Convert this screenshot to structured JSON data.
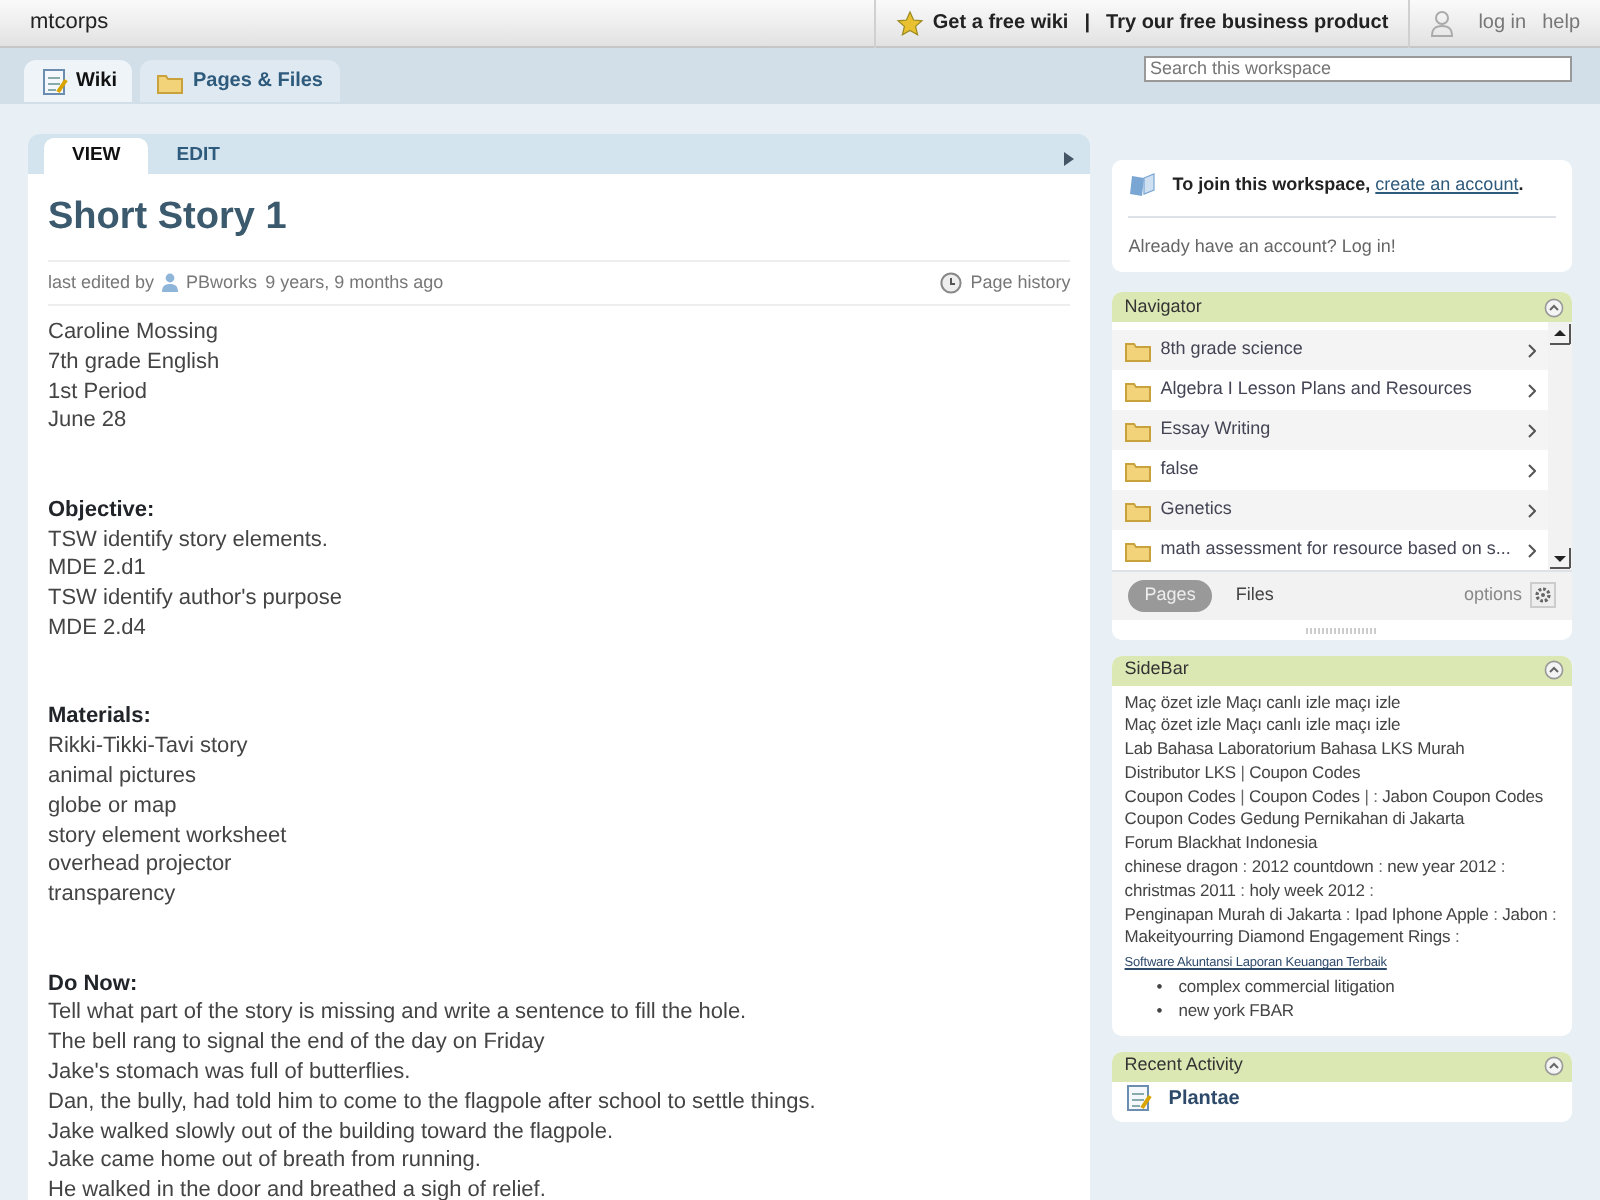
{
  "topbar": {
    "site": "mtcorps",
    "promo": "Get a free wiki",
    "separator": "|",
    "business": "Try our free business product",
    "login": "log in",
    "help": "help"
  },
  "tabs": [
    {
      "label": "Wiki",
      "selected": true
    },
    {
      "label": "Pages & Files",
      "selected": false
    }
  ],
  "search": {
    "placeholder": "Search this workspace"
  },
  "page": {
    "view_tabs": [
      {
        "label": "VIEW",
        "selected": true
      },
      {
        "label": "EDIT",
        "selected": false
      }
    ],
    "title": "Short Story 1",
    "meta": {
      "prefix": "last edited by",
      "user": "PBworks",
      "time": "9 years, 9 months ago"
    },
    "history": "Page history",
    "blocks": [
      {
        "lines": [
          "Caroline Mossing",
          "7th grade English",
          "1st Period",
          "June 28"
        ]
      },
      {
        "heading": "Objective:",
        "lines": [
          "TSW identify story elements.",
          "MDE 2.d1",
          "TSW identify author's purpose",
          "MDE 2.d4"
        ]
      },
      {
        "heading": "Materials:",
        "lines": [
          "Rikki-Tikki-Tavi story",
          "animal pictures",
          "globe or map",
          "story element worksheet",
          "overhead projector",
          "transparency"
        ]
      },
      {
        "heading": "Do Now:",
        "lines": [
          "Tell what part of the story is missing and write a sentence to fill the hole.",
          "The bell rang to signal the end of the day on Friday",
          "Jake's stomach was full of butterflies.",
          "Dan, the bully, had told him to come to the flagpole after school to settle things.",
          "Jake walked slowly out of the building toward the flagpole.",
          "Jake came home out of breath from running.",
          "He walked in the door and breathed a sigh of relief."
        ]
      }
    ]
  },
  "join": {
    "text": "To join this workspace,",
    "link": "create an account",
    "end": ".",
    "login_text": "Already have an account?",
    "login_link": "Log in",
    "login_end": "!"
  },
  "navigator": {
    "title": "Navigator",
    "items": [
      "8th grade science",
      "Algebra I Lesson Plans and Resources",
      "Essay Writing",
      "false",
      "Genetics",
      "math assessment for resource based on s..."
    ],
    "footer_tabs": [
      {
        "label": "Pages",
        "selected": true
      },
      {
        "label": "Files",
        "selected": false
      }
    ],
    "options": "options"
  },
  "sidebar": {
    "title": "SideBar",
    "paragraphs": [
      [
        {
          "kind": "link",
          "text": "Maç özet izle"
        },
        {
          "kind": "link",
          "text": "Maçı canlı izle"
        },
        {
          "kind": "link",
          "text": "maçı izle"
        }
      ],
      [
        {
          "kind": "link",
          "text": "Maç özet izle"
        },
        {
          "kind": "link",
          "text": "Maçı canlı izle"
        },
        {
          "kind": "link",
          "text": "maçı izle"
        }
      ],
      [
        {
          "kind": "link",
          "text": "Lab Bahasa"
        },
        {
          "kind": "link",
          "text": "Laboratorium Bahasa"
        },
        {
          "kind": "link",
          "text": "LKS Murah"
        },
        {
          "kind": "link",
          "text": "Distributor LKS"
        },
        {
          "kind": "text",
          "text": "|"
        },
        {
          "kind": "link",
          "text": "Coupon Codes"
        }
      ],
      [
        {
          "kind": "link",
          "text": "Coupon Codes"
        },
        {
          "kind": "text",
          "text": "|"
        },
        {
          "kind": "link",
          "text": "Coupon Codes"
        },
        {
          "kind": "text",
          "text": "| :"
        },
        {
          "kind": "link",
          "text": "Jabon"
        },
        {
          "kind": "link",
          "text": "Coupon Codes"
        },
        {
          "kind": "link",
          "text": "Coupon Codes"
        },
        {
          "kind": "link",
          "text": "Gedung Pernikahan di Jakarta"
        },
        {
          "kind": "link",
          "text": "Forum Blackhat Indonesia"
        }
      ],
      [
        {
          "kind": "link",
          "text": "chinese dragon"
        },
        {
          "kind": "text",
          "text": ":"
        },
        {
          "kind": "link",
          "text": "2012 countdown"
        },
        {
          "kind": "text",
          "text": ":"
        },
        {
          "kind": "link",
          "text": "new year 2012"
        },
        {
          "kind": "text",
          "text": ":"
        },
        {
          "kind": "link",
          "text": "christmas 2011"
        },
        {
          "kind": "text",
          "text": ":"
        },
        {
          "kind": "link",
          "text": "holy week 2012"
        },
        {
          "kind": "text",
          "text": ":"
        },
        {
          "kind": "link",
          "text": "Penginapan Murah di Jakarta"
        },
        {
          "kind": "text",
          "text": ":"
        },
        {
          "kind": "link",
          "text": "Ipad Iphone Apple"
        },
        {
          "kind": "text",
          "text": ":"
        },
        {
          "kind": "link",
          "text": "Jabon"
        },
        {
          "kind": "text",
          "text": ":"
        },
        {
          "kind": "link",
          "text": "Makeityourring Diamond Engagement Rings"
        },
        {
          "kind": "text",
          "text": ":"
        },
        {
          "kind": "small-link",
          "text": "Software Akuntansi Laporan Keuangan Terbaik"
        }
      ]
    ],
    "bullets": [
      {
        "marker": "•",
        "text": "complex commercial litigation"
      },
      {
        "marker": "•",
        "text": "new york FBAR"
      }
    ]
  },
  "recent": {
    "title": "Recent Activity",
    "items": [
      "Plantae"
    ]
  }
}
